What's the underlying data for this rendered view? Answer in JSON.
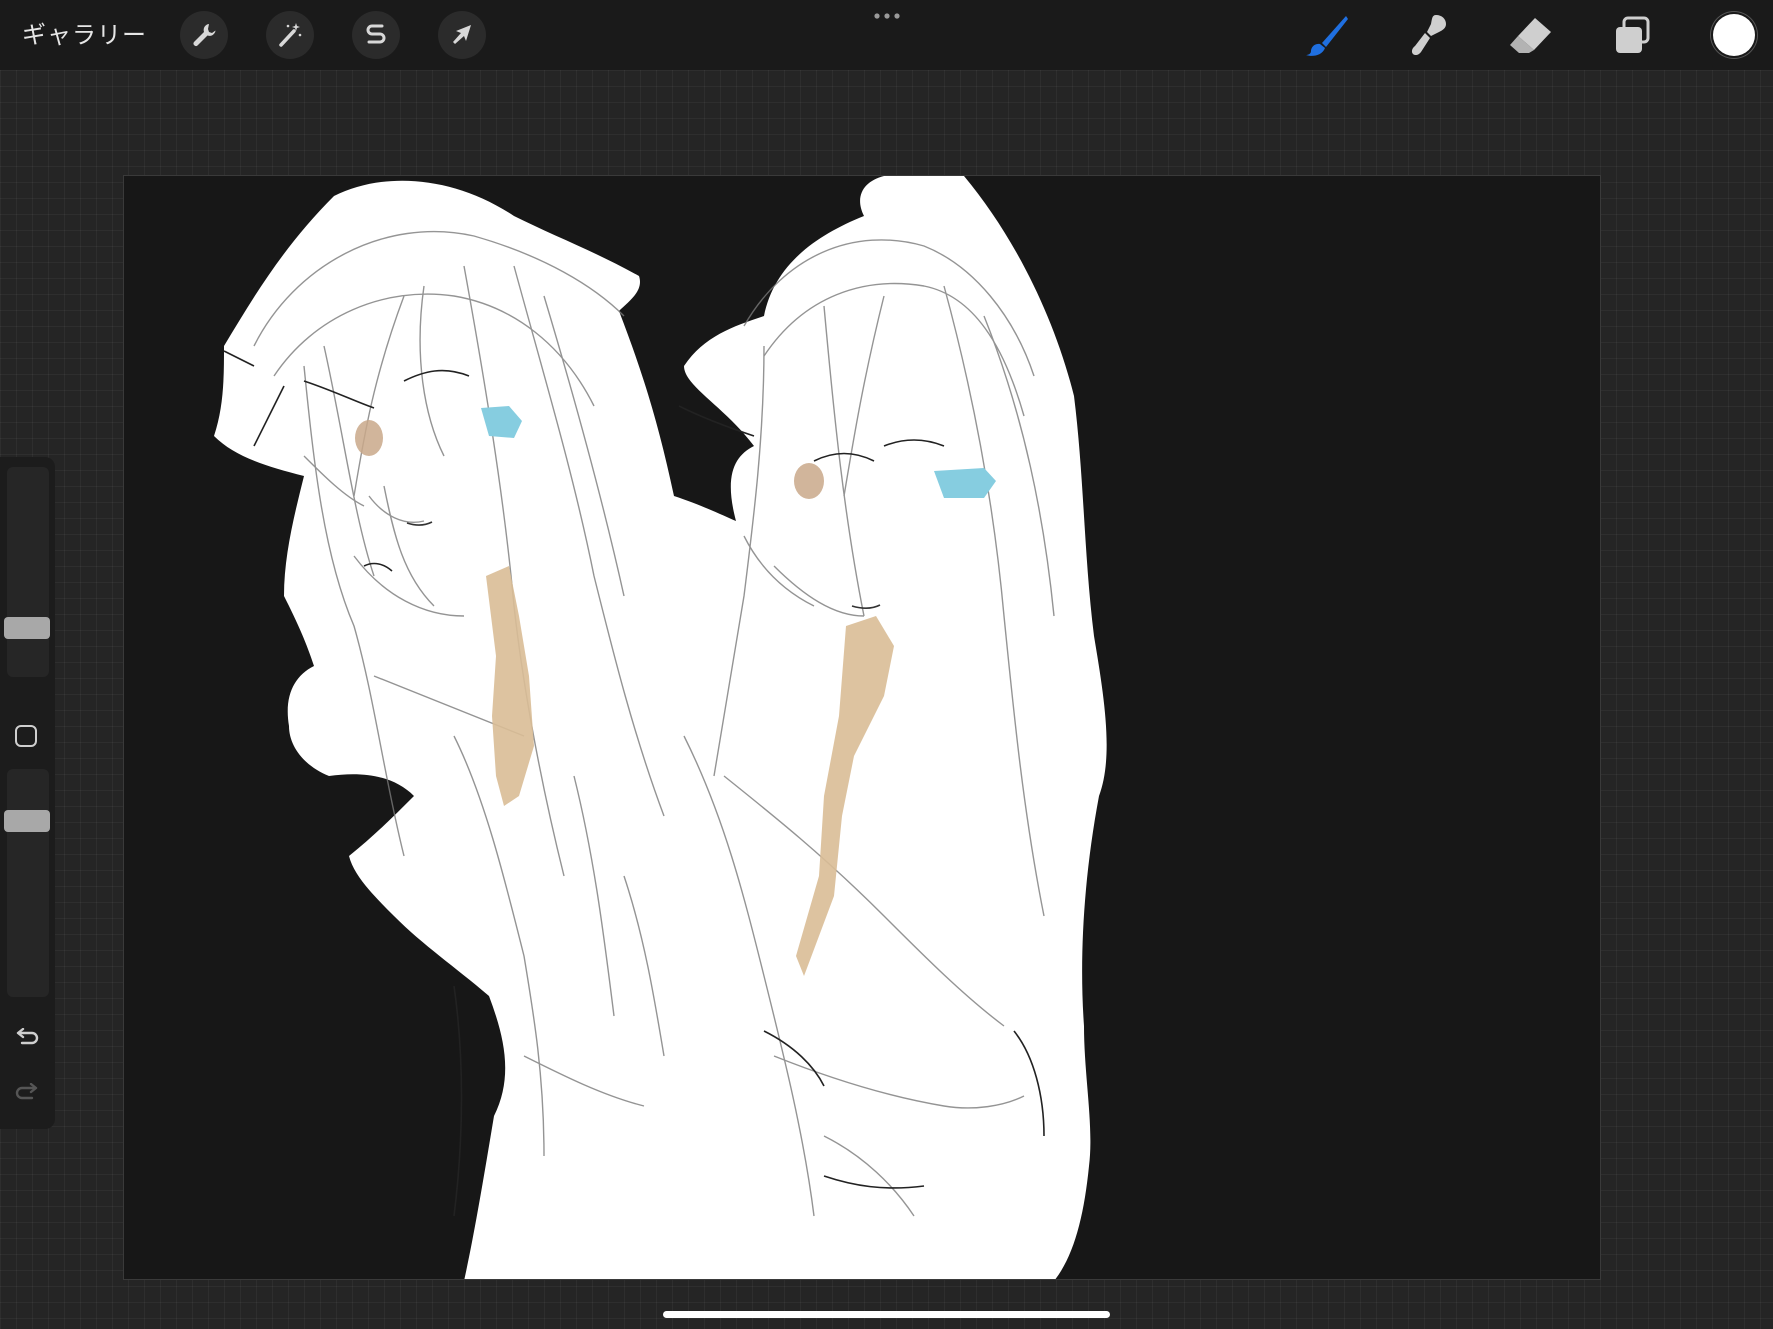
{
  "app": {
    "gallery_label": "ギャラリー"
  },
  "toolbar": {
    "left_tools": [
      {
        "name": "actions",
        "icon": "wrench-icon"
      },
      {
        "name": "adjustments",
        "icon": "magic-wand-icon"
      },
      {
        "name": "selection",
        "icon": "selection-s-icon"
      },
      {
        "name": "transform",
        "icon": "arrow-cursor-icon"
      }
    ],
    "more_icon": "ellipsis-icon",
    "right_tools": [
      {
        "name": "brush",
        "icon": "brush-icon",
        "active": true
      },
      {
        "name": "smudge",
        "icon": "smudge-icon",
        "active": false
      },
      {
        "name": "eraser",
        "icon": "eraser-icon",
        "active": false
      },
      {
        "name": "layers",
        "icon": "layers-icon",
        "active": false
      }
    ],
    "current_color": "#ffffff"
  },
  "sidebar": {
    "brush_size_level": 0.2,
    "opacity_level": 0.8,
    "undo_icon": "undo-icon",
    "redo_icon": "redo-icon",
    "redo_enabled": false
  },
  "colors": {
    "accent_blue": "#1f6fe0",
    "tie": "#d9bc96",
    "eye_left_girl_left": "#c9a889",
    "eye_blue": "#86cde0"
  }
}
